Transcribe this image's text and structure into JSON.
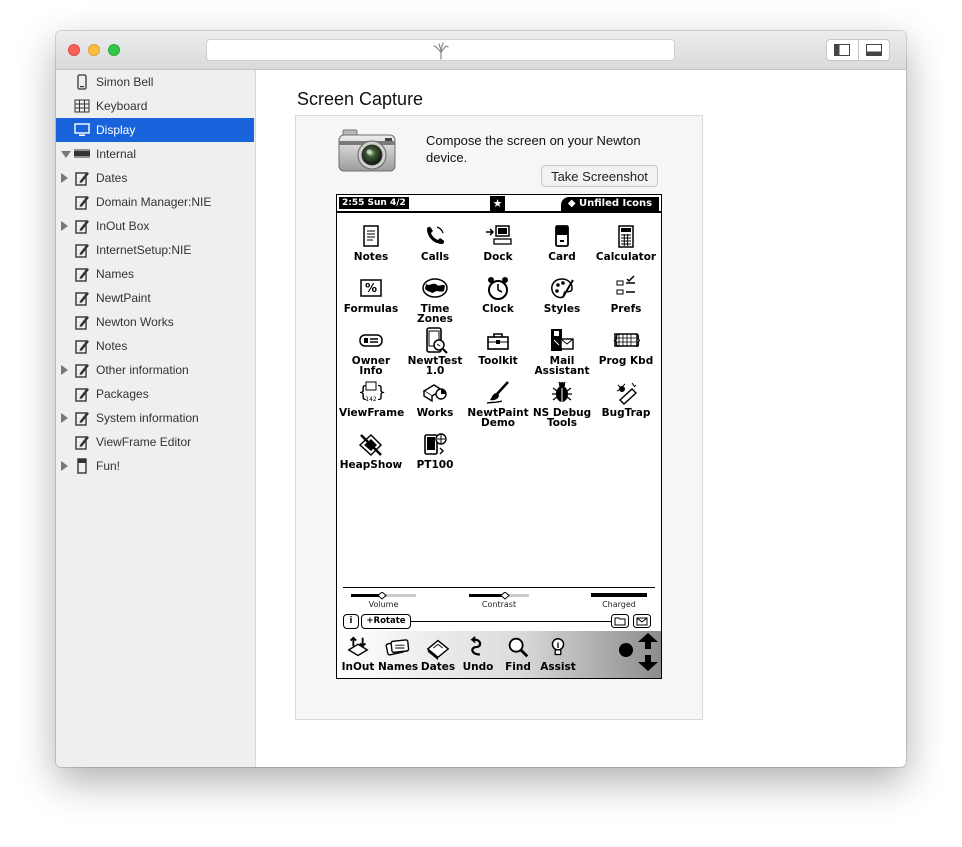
{
  "sidebar": {
    "items": [
      {
        "label": "Simon Bell",
        "icon": "phone-device-icon",
        "expand": "none",
        "selected": false
      },
      {
        "label": "Keyboard",
        "icon": "keyboard-grid-icon",
        "expand": "none",
        "selected": false
      },
      {
        "label": "Display",
        "icon": "monitor-icon",
        "expand": "none",
        "selected": true
      },
      {
        "label": "Internal",
        "icon": "memory-chip-icon",
        "expand": "down",
        "selected": false
      },
      {
        "label": "Dates",
        "icon": "soup-icon",
        "expand": "right",
        "selected": false
      },
      {
        "label": "Domain Manager:NIE",
        "icon": "soup-icon",
        "expand": "none",
        "selected": false
      },
      {
        "label": "InOut Box",
        "icon": "soup-icon",
        "expand": "right",
        "selected": false
      },
      {
        "label": "InternetSetup:NIE",
        "icon": "soup-icon",
        "expand": "none",
        "selected": false
      },
      {
        "label": "Names",
        "icon": "soup-icon",
        "expand": "none",
        "selected": false
      },
      {
        "label": "NewtPaint",
        "icon": "soup-icon",
        "expand": "none",
        "selected": false
      },
      {
        "label": "Newton Works",
        "icon": "soup-icon",
        "expand": "none",
        "selected": false
      },
      {
        "label": "Notes",
        "icon": "soup-icon",
        "expand": "none",
        "selected": false
      },
      {
        "label": "Other information",
        "icon": "soup-icon",
        "expand": "right",
        "selected": false
      },
      {
        "label": "Packages",
        "icon": "soup-icon",
        "expand": "none",
        "selected": false
      },
      {
        "label": "System information",
        "icon": "soup-icon",
        "expand": "right",
        "selected": false
      },
      {
        "label": "ViewFrame Editor",
        "icon": "soup-icon",
        "expand": "none",
        "selected": false
      },
      {
        "label": "Fun!",
        "icon": "card-icon",
        "expand": "right",
        "selected": false
      }
    ]
  },
  "main": {
    "title": "Screen Capture",
    "compose_text": "Compose the screen on your Newton device.",
    "screenshot_button": "Take Screenshot"
  },
  "newton": {
    "time": "2:55 Sun 4/2",
    "star": "★",
    "folder": "◆ Unfiled Icons",
    "apps": [
      {
        "name": "Notes",
        "icon": "notes-icon"
      },
      {
        "name": "Calls",
        "icon": "phone-icon"
      },
      {
        "name": "Dock",
        "icon": "dock-computer-icon"
      },
      {
        "name": "Card",
        "icon": "card-icon"
      },
      {
        "name": "Calculator",
        "icon": "calculator-icon"
      },
      {
        "name": "Formulas",
        "icon": "formulas-icon"
      },
      {
        "name": "Time Zones",
        "icon": "globe-icon"
      },
      {
        "name": "Clock",
        "icon": "clock-icon"
      },
      {
        "name": "Styles",
        "icon": "palette-icon"
      },
      {
        "name": "Prefs",
        "icon": "prefs-icon"
      },
      {
        "name": "Owner Info",
        "icon": "owner-card-icon"
      },
      {
        "name": "NewtTest 1.0",
        "icon": "newton-test-icon"
      },
      {
        "name": "Toolkit",
        "icon": "toolbox-icon"
      },
      {
        "name": "Mail Assistant",
        "icon": "mail-assistant-icon"
      },
      {
        "name": "Prog Kbd",
        "icon": "prog-keyboard-icon"
      },
      {
        "name": "ViewFrame",
        "icon": "viewframe-icon"
      },
      {
        "name": "Works",
        "icon": "works-icon"
      },
      {
        "name": "NewtPaint Demo",
        "icon": "paintbrush-icon"
      },
      {
        "name": "NS Debug Tools",
        "icon": "bug-icon"
      },
      {
        "name": "BugTrap",
        "icon": "bugtrap-icon"
      },
      {
        "name": "HeapShow",
        "icon": "heapshow-icon"
      },
      {
        "name": "PT100",
        "icon": "pt100-icon"
      }
    ],
    "sliders": [
      {
        "label": "Volume",
        "level": 0.48
      },
      {
        "label": "Contrast",
        "level": 0.6
      },
      {
        "label": "Charged",
        "level": 1.0
      }
    ],
    "info_button": "i",
    "rotate_button": "+Rotate",
    "tray": [
      {
        "label": "InOut",
        "icon": "inout-icon"
      },
      {
        "label": "Names",
        "icon": "names-icon"
      },
      {
        "label": "Dates",
        "icon": "dates-icon"
      },
      {
        "label": "Undo",
        "icon": "undo-icon"
      },
      {
        "label": "Find",
        "icon": "find-icon"
      },
      {
        "label": "Assist",
        "icon": "assist-icon"
      }
    ]
  }
}
